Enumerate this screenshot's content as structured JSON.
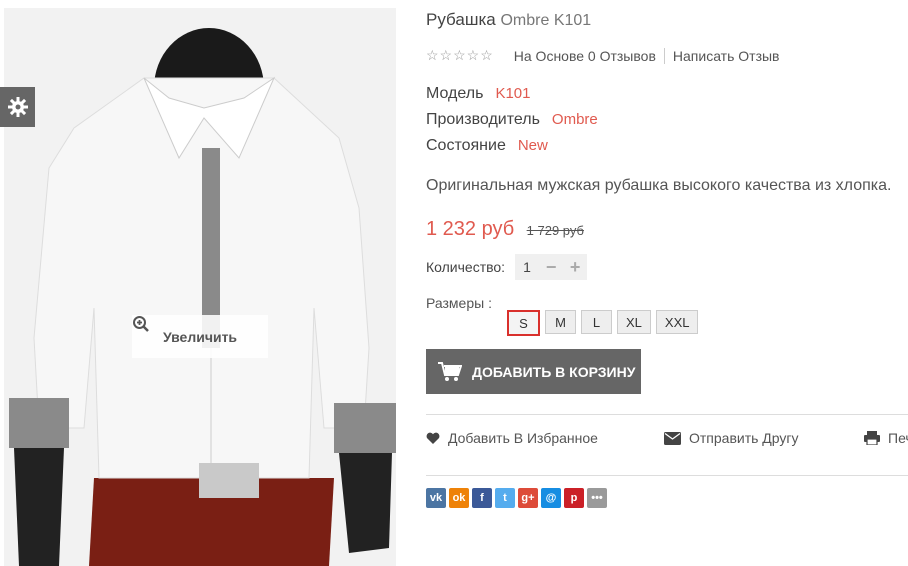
{
  "product": {
    "title": "Рубашка",
    "title_code": "Ombre K101",
    "rating_stars": "☆☆☆☆☆",
    "reviews_label": "На Основе 0 Отзывов",
    "write_review_label": "Написать Отзыв",
    "model_label": "Модель",
    "model_value": "K101",
    "manufacturer_label": "Производитель",
    "manufacturer_value": "Ombre",
    "condition_label": "Состояние",
    "condition_value": "New",
    "description": "Оригинальная мужская рубашка высокого качества из хлопка.",
    "price_current": "1 232 руб",
    "price_old": "1 729 руб",
    "quantity_label": "Количество:",
    "quantity_value": "1",
    "quantity_minus": "−",
    "quantity_plus": "+",
    "sizes_label": "Размеры :",
    "sizes": [
      "S",
      "M",
      "L",
      "XL",
      "XXL"
    ],
    "selected_size": "S",
    "add_to_cart_label": "ДОБАВИТЬ В КОРЗИНУ"
  },
  "image": {
    "zoom_label": "Увеличить"
  },
  "actions": {
    "wishlist_label": "Добавить В Избранное",
    "send_friend_label": "Отправить Другу",
    "print_label": "Печ"
  },
  "social": [
    {
      "name": "vk",
      "glyph": "vk",
      "color": "#4c75a3"
    },
    {
      "name": "odnoklassniki",
      "glyph": "ok",
      "color": "#ee8208"
    },
    {
      "name": "facebook",
      "glyph": "f",
      "color": "#3b5998"
    },
    {
      "name": "twitter",
      "glyph": "t",
      "color": "#55acee"
    },
    {
      "name": "google-plus",
      "glyph": "g+",
      "color": "#dd4b39"
    },
    {
      "name": "mail",
      "glyph": "@",
      "color": "#168de2"
    },
    {
      "name": "pinterest",
      "glyph": "p",
      "color": "#cb2027"
    },
    {
      "name": "more",
      "glyph": "•••",
      "color": "#9a9a9a"
    }
  ],
  "colors": {
    "accent": "#e05a4f",
    "button": "#666666",
    "selected_border": "#d9302c"
  }
}
